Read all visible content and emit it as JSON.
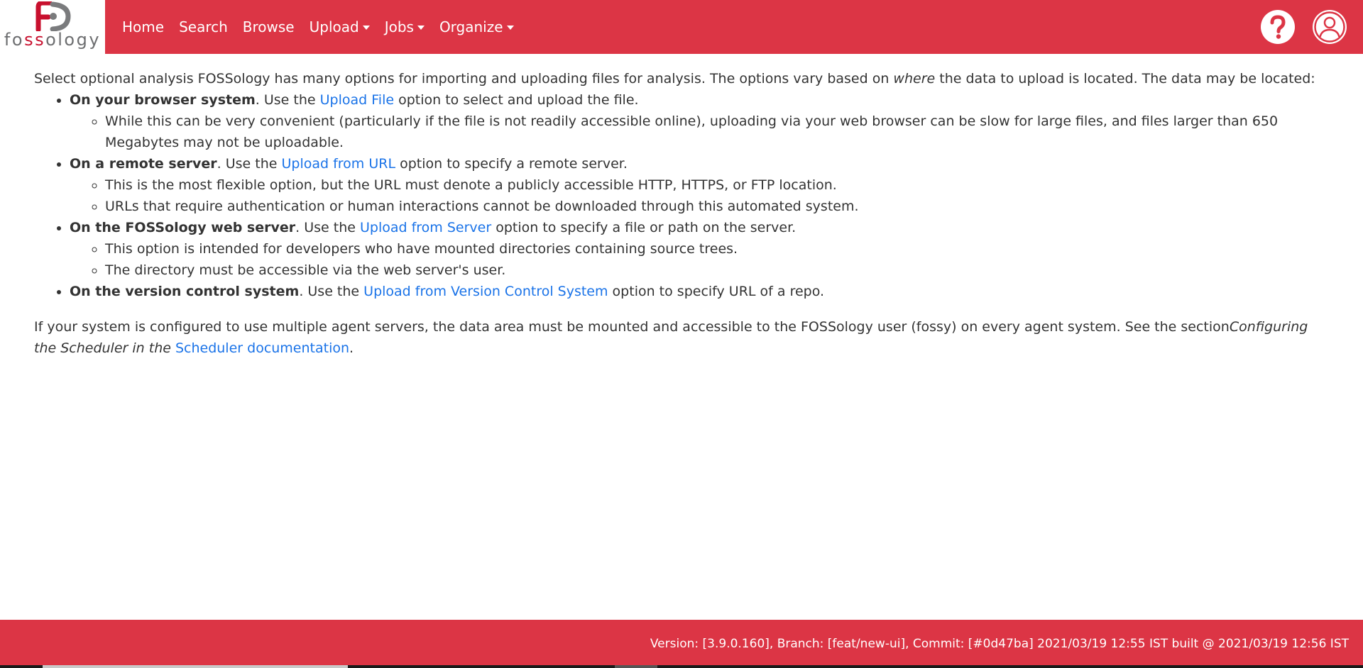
{
  "app": {
    "logo_text_start": "fo",
    "logo_text_accent": "ss",
    "logo_text_end": "ology"
  },
  "nav": {
    "items": [
      {
        "label": "Home",
        "dropdown": false
      },
      {
        "label": "Search",
        "dropdown": false
      },
      {
        "label": "Browse",
        "dropdown": false
      },
      {
        "label": "Upload",
        "dropdown": true
      },
      {
        "label": "Jobs",
        "dropdown": true
      },
      {
        "label": "Organize",
        "dropdown": true
      }
    ],
    "help_icon": "question-circle-icon",
    "user_icon": "user-circle-icon"
  },
  "content": {
    "intro": {
      "before": "Select optional analysis FOSSology has many options for importing and uploading files for analysis. The options vary based on ",
      "emph": "where",
      "after": " the data to upload is located. The data may be located:"
    },
    "items": [
      {
        "bold": "On your browser system",
        "pre": ". Use the ",
        "link": "Upload File",
        "post": " option to select and upload the file.",
        "sub": [
          "While this can be very convenient (particularly if the file is not readily accessible online), uploading via your web browser can be slow for large files, and files larger than 650 Megabytes may not be uploadable."
        ]
      },
      {
        "bold": "On a remote server",
        "pre": ". Use the ",
        "link": "Upload from URL",
        "post": " option to specify a remote server.",
        "sub": [
          "This is the most flexible option, but the URL must denote a publicly accessible HTTP, HTTPS, or FTP location.",
          "URLs that require authentication or human interactions cannot be downloaded through this automated system."
        ]
      },
      {
        "bold": "On the FOSSology web server",
        "pre": ". Use the ",
        "link": "Upload from Server",
        "post": " option to specify a file or path on the server.",
        "sub": [
          "This option is intended for developers who have mounted directories containing source trees.",
          "The directory must be accessible via the web server's user."
        ]
      },
      {
        "bold": "On the version control system",
        "pre": ". Use the ",
        "link": "Upload from Version Control System",
        "post": " option to specify URL of a repo.",
        "sub": []
      }
    ],
    "outro": {
      "before": "If your system is configured to use multiple agent servers, the data area must be mounted and accessible to the FOSSology user (fossy) on every agent system. See the section",
      "emph": "Configuring the Scheduler in the ",
      "link": "Scheduler documentation",
      "after": "."
    }
  },
  "footer": {
    "text": "Version: [3.9.0.160], Branch: [feat/new-ui], Commit: [#0d47ba] 2021/03/19 12:55 IST built @ 2021/03/19 12:56 IST"
  },
  "colors": {
    "brand": "#dc3545",
    "link": "#1a73e8",
    "text": "#333333"
  }
}
